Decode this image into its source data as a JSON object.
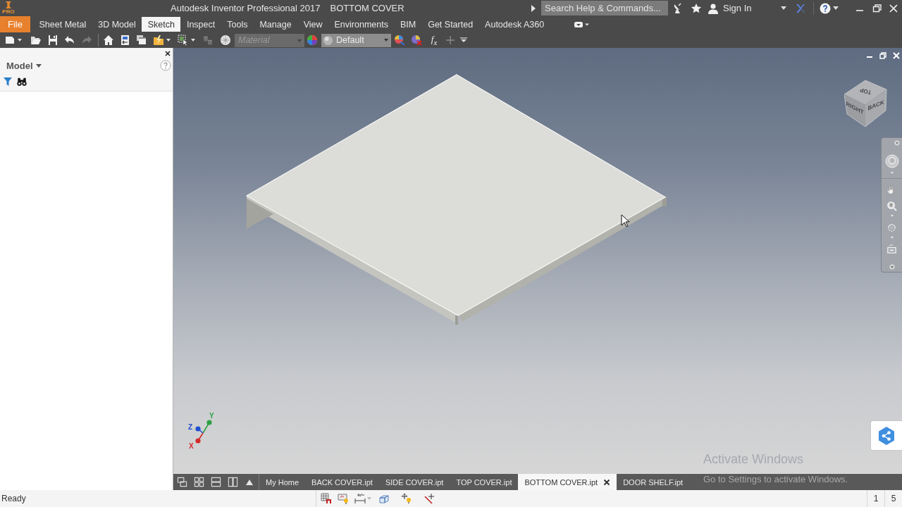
{
  "window": {
    "logo_text": "PRO",
    "title": "Autodesk Inventor Professional 2017",
    "document": "BOTTOM COVER"
  },
  "search": {
    "placeholder": "Search Help & Commands..."
  },
  "account": {
    "label": "Sign In"
  },
  "ribbon_tabs": [
    {
      "label": "File",
      "kind": "file",
      "selected": false
    },
    {
      "label": "Sheet Metal",
      "kind": "tab",
      "selected": false
    },
    {
      "label": "3D Model",
      "kind": "tab",
      "selected": false
    },
    {
      "label": "Sketch",
      "kind": "tab",
      "selected": true
    },
    {
      "label": "Inspect",
      "kind": "tab",
      "selected": false
    },
    {
      "label": "Tools",
      "kind": "tab",
      "selected": false
    },
    {
      "label": "Manage",
      "kind": "tab",
      "selected": false
    },
    {
      "label": "View",
      "kind": "tab",
      "selected": false
    },
    {
      "label": "Environments",
      "kind": "tab",
      "selected": false
    },
    {
      "label": "BIM",
      "kind": "tab",
      "selected": false
    },
    {
      "label": "Get Started",
      "kind": "tab",
      "selected": false
    },
    {
      "label": "Autodesk A360",
      "kind": "tab",
      "selected": false
    }
  ],
  "quick_access": {
    "material": {
      "placeholder": "Material",
      "disabled": true
    },
    "appearance": {
      "value": "Default"
    },
    "formula": "*f*$_{x}$"
  },
  "browser": {
    "title": "Model"
  },
  "viewport": {
    "view_cube": [
      "TOP",
      "RIGHT",
      "BACK"
    ],
    "axes": [
      {
        "label": "Y",
        "color": "#2ea043"
      },
      {
        "label": "Z",
        "color": "#1f4fd1"
      },
      {
        "label": "X",
        "color": "#d42a2a"
      }
    ]
  },
  "document_tabs": [
    {
      "label": "My Home",
      "selected": false
    },
    {
      "label": "BACK COVER.ipt",
      "selected": false
    },
    {
      "label": "SIDE COVER.ipt",
      "selected": false
    },
    {
      "label": "TOP COVER.ipt",
      "selected": false
    },
    {
      "label": "BOTTOM COVER.ipt",
      "selected": true
    },
    {
      "label": "DOOR SHELF.ipt",
      "selected": false
    }
  ],
  "activation_notice": {
    "title": "Activate Windows",
    "message": "Go to Settings to activate Windows."
  },
  "status_bar": {
    "text": "Ready",
    "counts": [
      "1",
      "5"
    ]
  }
}
